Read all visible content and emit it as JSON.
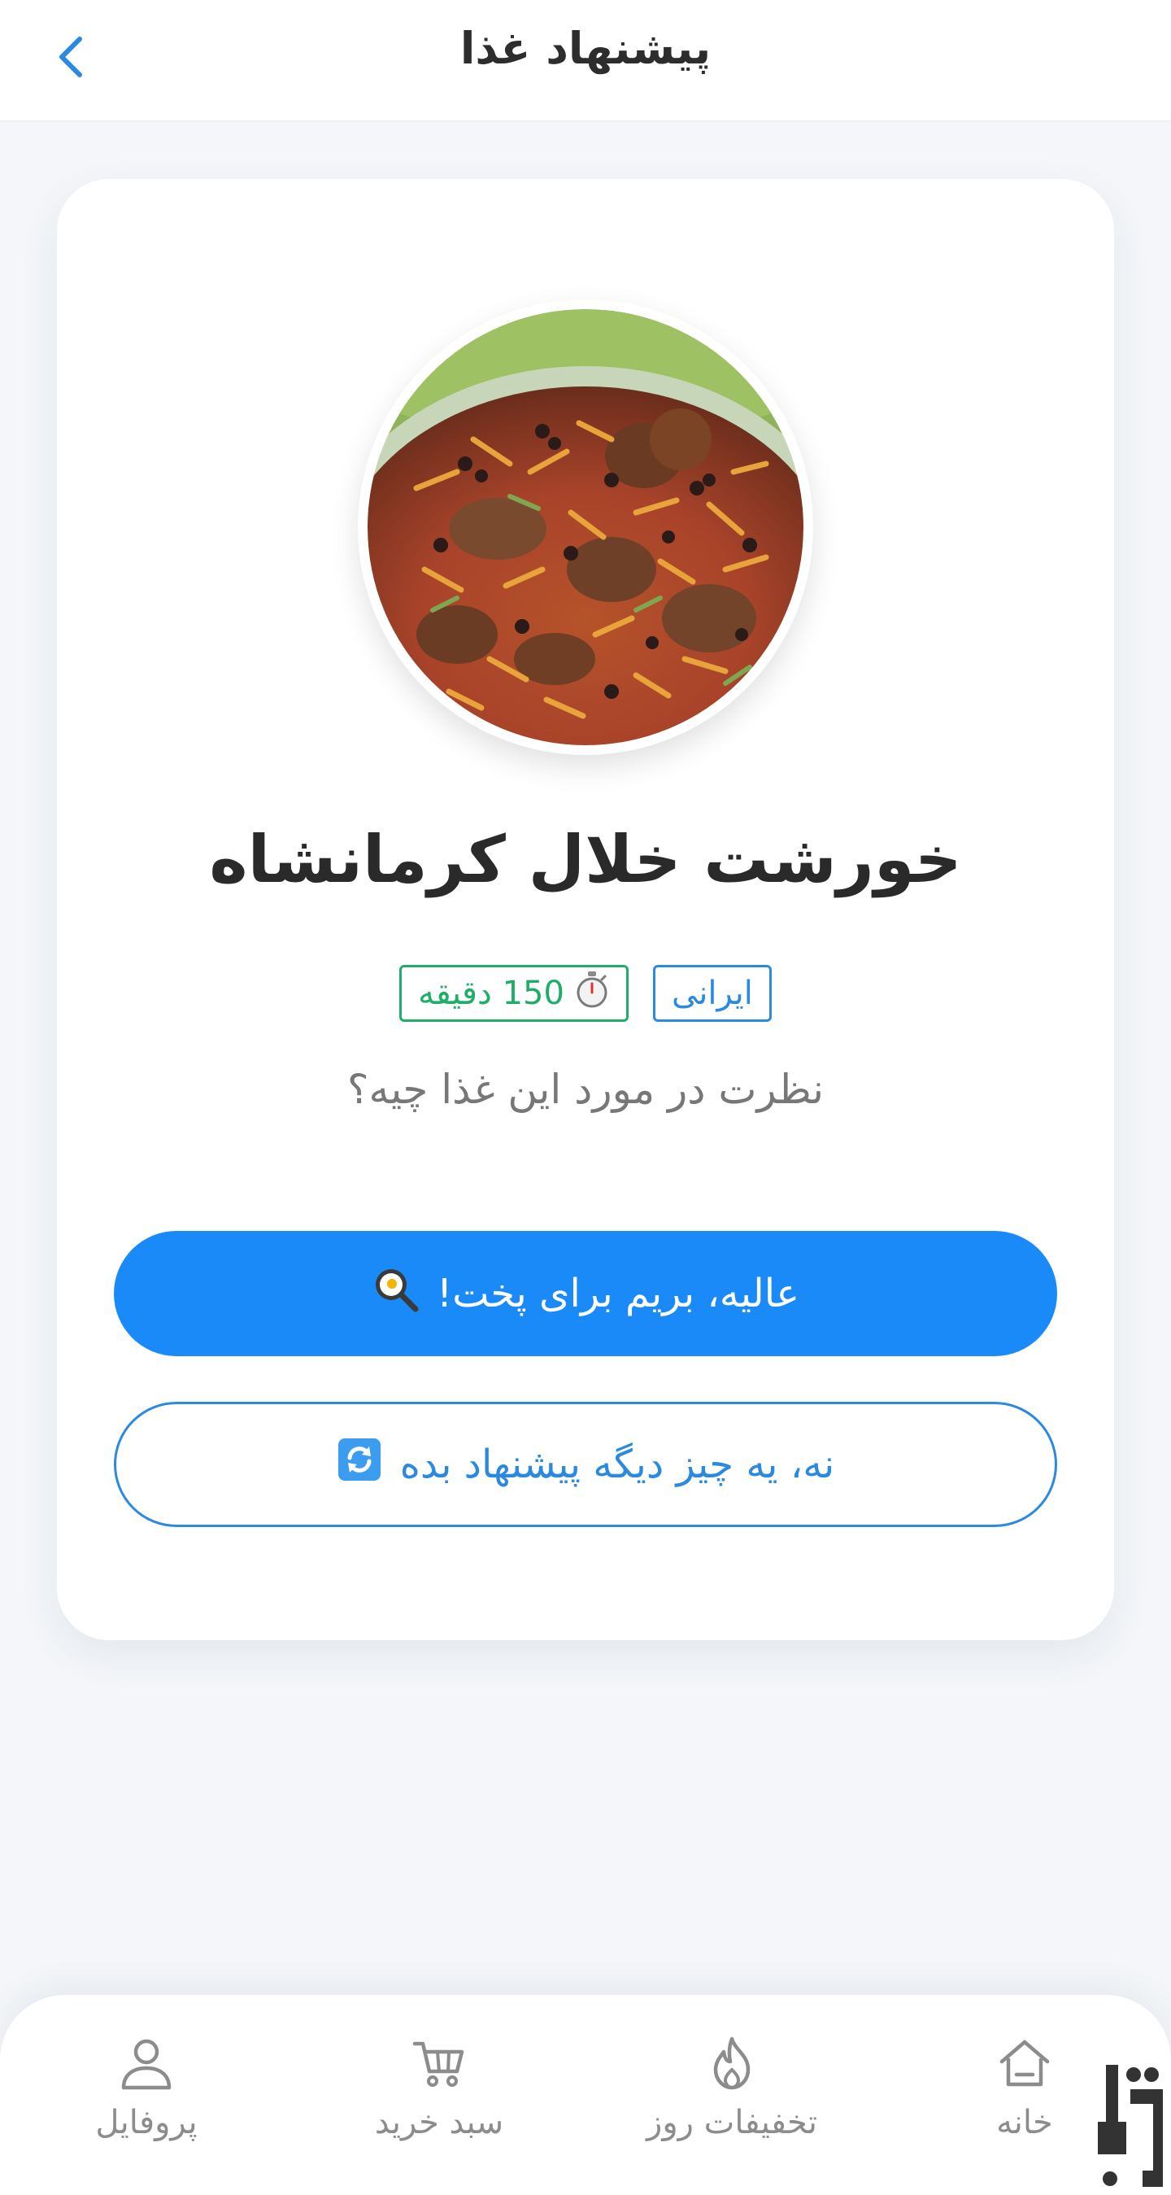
{
  "header": {
    "title": "پیشنهاد غذا",
    "back_icon": "chevron-left-icon"
  },
  "food": {
    "name": "خورشت خلال کرمانشاه",
    "cuisine_tag": "ایرانی",
    "time_tag": "150 دقیقه",
    "time_icon": "stopwatch-icon",
    "question": "نظرت در مورد این غذا چیه؟"
  },
  "actions": {
    "accept_label": "عالیه، بریم برای پخت!",
    "accept_icon": "frying-pan-icon",
    "reject_label": "نه، یه چیز دیگه پیشنهاد بده",
    "reject_icon": "refresh-icon"
  },
  "nav": {
    "items": [
      {
        "label": "خانه",
        "icon": "home-icon"
      },
      {
        "label": "تخفیفات روز",
        "icon": "flame-icon"
      },
      {
        "label": "سبد خرید",
        "icon": "cart-icon"
      },
      {
        "label": "پروفایل",
        "icon": "user-icon"
      }
    ]
  },
  "colors": {
    "accent": "#1a8af8",
    "outline_blue": "#2b8ae0",
    "green": "#1fae6a",
    "background": "#f4f6f9"
  }
}
